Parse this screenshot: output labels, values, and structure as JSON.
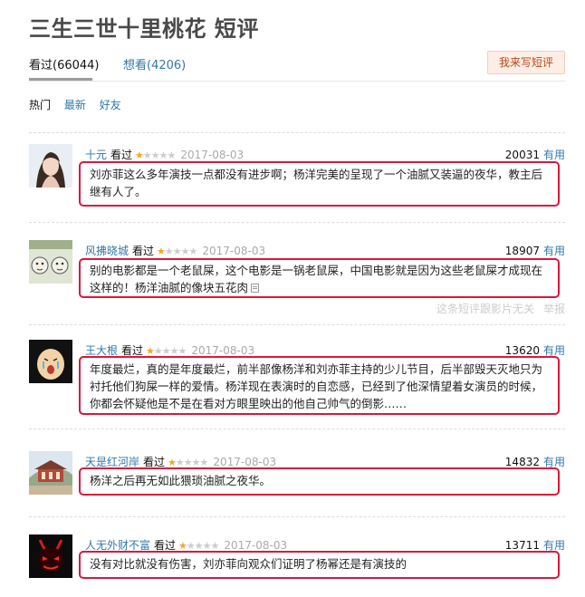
{
  "page": {
    "title": "三生三世十里桃花 短评",
    "tabs": [
      {
        "label": "看过(66044)",
        "active": true
      },
      {
        "label": "想看(4206)",
        "active": false
      }
    ],
    "write_button": "我来写短评",
    "filters": [
      {
        "label": "热门",
        "active": true
      },
      {
        "label": "最新",
        "active": false
      },
      {
        "label": "好友",
        "active": false
      }
    ]
  },
  "reviews": [
    {
      "user": "十元",
      "status": "看过",
      "rating": 1,
      "max_rating": 5,
      "date": "2017-08-03",
      "votes": "20031",
      "useful_label": "有用",
      "text": "刘亦菲这么多年演技一点都没有进步啊；杨洋完美的呈现了一个油腻又装逼的夜华，教主后继有人了。",
      "avatar": "woman-portrait"
    },
    {
      "user": "风拂晓城",
      "status": "看过",
      "rating": 1,
      "max_rating": 5,
      "date": "2017-08-03",
      "votes": "18907",
      "useful_label": "有用",
      "text": "别的电影都是一个老鼠屎，这个电影是一锅老鼠屎，中国电影就是因为这些老鼠屎才成现在这样的！杨洋油腻的像块五花肉",
      "avatar": "cartoon-faces",
      "footer": {
        "note": "这条短评跟影片无关",
        "report": "举报"
      }
    },
    {
      "user": "王大根",
      "status": "看过",
      "rating": 1,
      "max_rating": 5,
      "date": "2017-08-03",
      "votes": "13620",
      "useful_label": "有用",
      "text": "年度最烂，真的是年度最烂，前半部像杨洋和刘亦菲主持的少儿节目，后半部毁天灭地只为衬托他们狗屎一样的爱情。杨洋现在表演时的自恋感，已经到了他深情望着女演员的时候，你都会怀疑他是不是在看对方眼里映出的他自己帅气的倒影……",
      "avatar": "crying-cartoon"
    },
    {
      "user": "天是红河岸",
      "status": "看过",
      "rating": 1,
      "max_rating": 5,
      "date": "2017-08-03",
      "votes": "14832",
      "useful_label": "有用",
      "text": "杨洋之后再无如此猥琐油腻之夜华。",
      "avatar": "garden-pavilion"
    },
    {
      "user": "人无外财不富",
      "status": "看过",
      "rating": 1,
      "max_rating": 5,
      "date": "2017-08-03",
      "votes": "13711",
      "useful_label": "有用",
      "text": "没有对比就没有伤害，刘亦菲向观众们证明了杨幂还是有演技的",
      "avatar": "red-mask"
    }
  ]
}
